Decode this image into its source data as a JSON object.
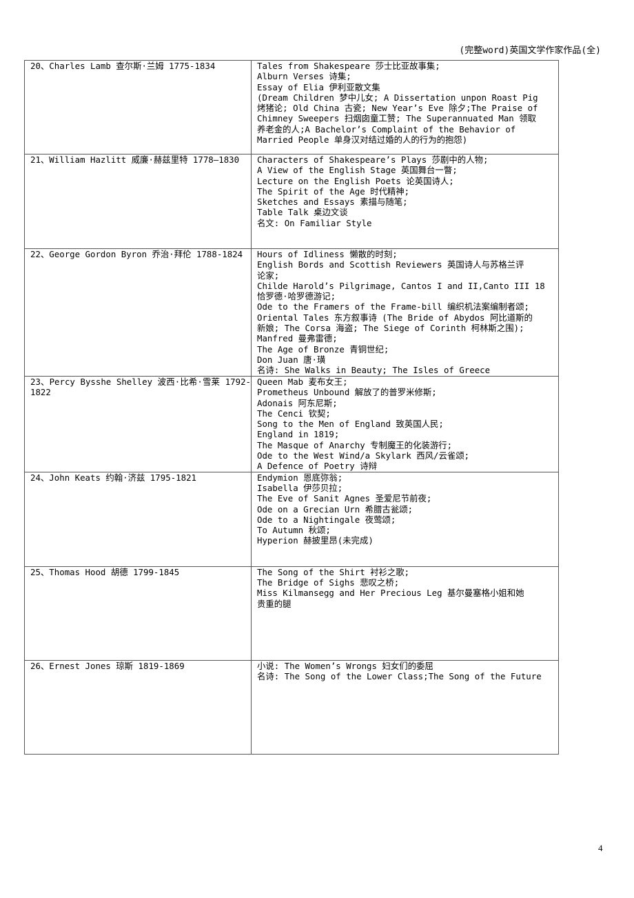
{
  "header": {
    "title": "(完整word)英国文学作家作品(全)"
  },
  "rows": [
    {
      "author": "20、Charles Lamb 查尔斯·兰姆 1775-1834",
      "works": [
        "Tales from Shakespeare 莎士比亚故事集;",
        "Alburn Verses 诗集;",
        "Essay of Elia 伊利亚散文集",
        "(Dream Children 梦中儿女; A Dissertation unpon Roast Pig",
        "烤猪论; Old China 古瓷; New Year’s Eve 除夕;The Praise of",
        "Chimney Sweepers 扫烟囱童工赞; The Superannuated Man 领取",
        "养老金的人;A Bachelor’s Complaint of the Behavior of",
        "Married People 单身汉对结过婚的人的行为的抱怨)"
      ]
    },
    {
      "author": "21、William Hazlitt 威廉·赫兹里特 1778—1830",
      "works": [
        "Characters of Shakespeare’s Plays 莎剧中的人物;",
        "A View of the English Stage 英国舞台一瞥;",
        "Lecture on the English Poets 论英国诗人;",
        "The Spirit of the Age 时代精神;",
        "Sketches and Essays 素描与随笔;",
        "Table Talk 桌边文谈",
        "名文: On Familiar Style"
      ]
    },
    {
      "author": "22、George Gordon Byron 乔治·拜伦 1788-1824",
      "works": [
        "Hours of Idliness 懒散的时刻;",
        "English Bords and Scottish Reviewers 英国诗人与苏格兰评",
        "论家;",
        "Childe Harold’s Pilgrimage, Cantos I and II,Canto III 18",
        "恰罗德·哈罗德游记;",
        "Ode to the Framers of the Frame-bill 编织机法案编制者颂;",
        "Oriental Tales 东方叙事诗 (The Bride of Abydos 阿比道斯的",
        "新娘; The Corsa 海盗; The Siege of Corinth 柯林斯之围);",
        "Manfred 曼弗雷德;",
        "The Age of Bronze 青铜世纪;",
        "Don Juan 唐·璜",
        "名诗: She Walks in Beauty; The Isles of Greece"
      ]
    },
    {
      "author": "23、Percy Bysshe Shelley 波西·比希·雪莱 1792-1822",
      "works": [
        "Queen Mab 麦布女王;",
        "Prometheus Unbound 解放了的普罗米修斯;",
        "Adonais 阿东尼斯;",
        "The Cenci 钦契;",
        "Song to the Men of England 致英国人民;",
        "England in 1819;",
        "The Masque of Anarchy 专制魔王的化装游行;",
        "Ode to the West Wind/a Skylark 西风/云雀颂;",
        "A Defence of Poetry 诗辩"
      ]
    },
    {
      "author": "24、John Keats 约翰·济兹 1795-1821",
      "works": [
        "Endymion 恩底弥翁;",
        "Isabella 伊莎贝拉;",
        "The Eve of Sanit Agnes 圣爱尼节前夜;",
        "Ode on a Grecian Urn 希腊古瓮颂;",
        "Ode to a Nightingale 夜莺颂;",
        "To Autumn 秋颂;",
        "Hyperion 赫披里昂(未完成)"
      ]
    },
    {
      "author": "25、Thomas Hood 胡德 1799-1845",
      "works": [
        "The Song of the Shirt 衬衫之歌;",
        "The Bridge of Sighs 悲叹之桥;",
        "Miss Kilmansegg and Her Precious Leg 基尔曼塞格小姐和她",
        "贵重的腿"
      ]
    },
    {
      "author": "26、Ernest Jones 琼斯 1819-1869",
      "works": [
        "小说: The Women’s Wrongs 妇女们的委屈",
        "名诗: The Song of the Lower Class;The Song of the Future"
      ]
    }
  ],
  "footer": {
    "page_number": "4"
  }
}
